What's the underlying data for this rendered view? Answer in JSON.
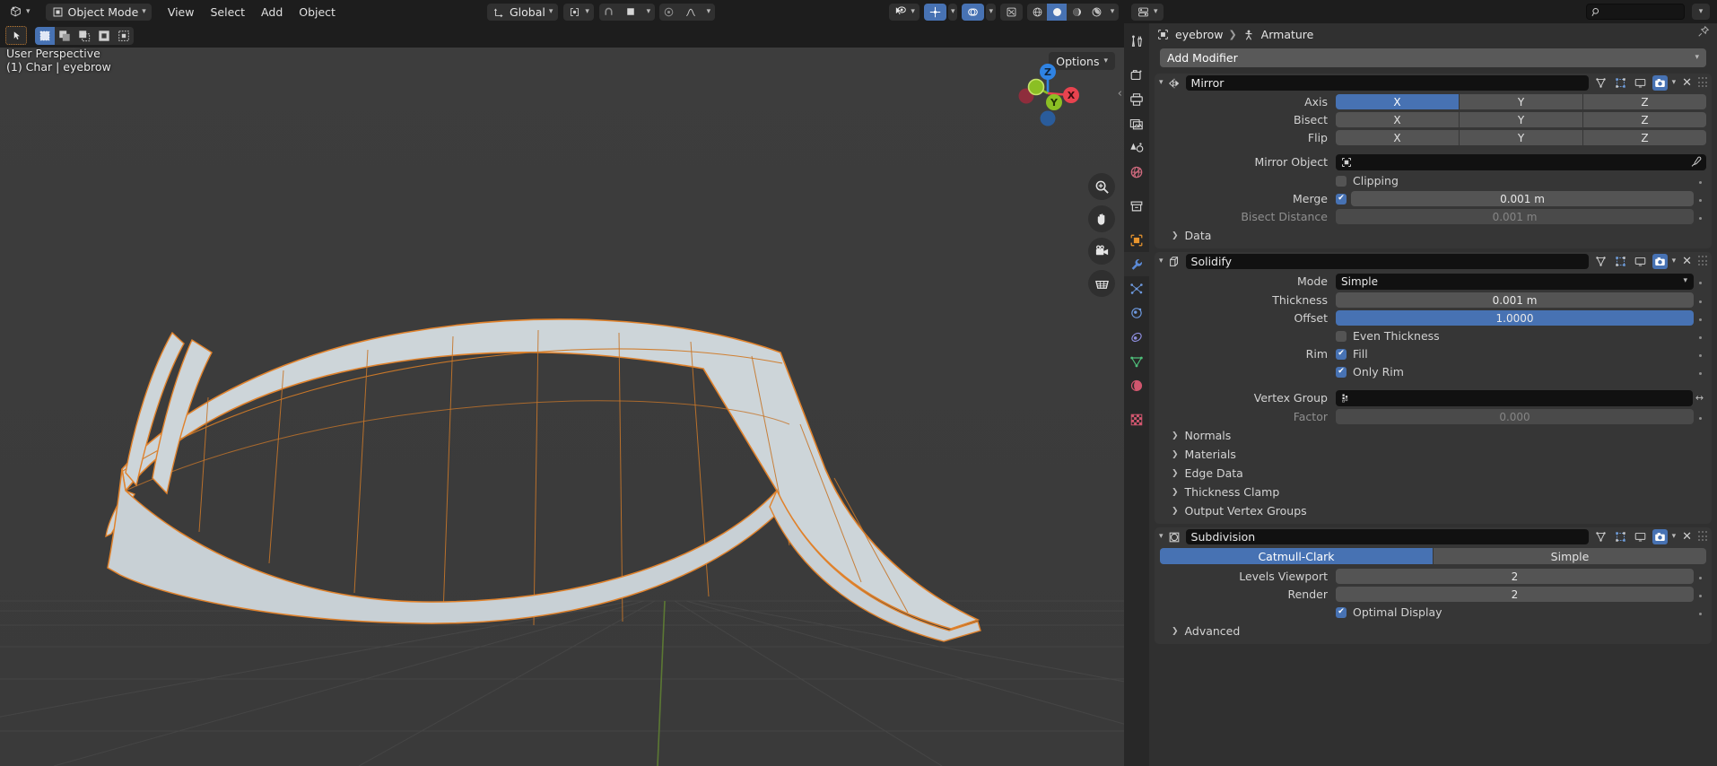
{
  "viewport_header": {
    "editor_type_icon": "editor-type-3dview-icon",
    "mode_selector": {
      "icon": "object-mode-icon",
      "label": "Object Mode"
    },
    "menus": [
      "View",
      "Select",
      "Add",
      "Object"
    ],
    "transform_orientation": {
      "icon": "orientation-icon",
      "label": "Global"
    },
    "pivot_icon": "pivot-point-icon",
    "snap_icon": "snap-magnet-icon",
    "snap_target_icon": "snap-target-icon",
    "proportional_icon": "proportional-edit-icon",
    "proportional_falloff_icon": "falloff-curve-icon",
    "visibility_icon": "object-visibility-icon",
    "shading_icons": [
      "shading-wireframe-icon",
      "shading-solid-icon",
      "shading-material-icon",
      "shading-rendered-icon"
    ],
    "gizmo_icon": "gizmo-icon",
    "overlays_icon": "overlays-icon",
    "xray_icon": "xray-toggle-icon",
    "options_label": "Options"
  },
  "toolbar_row2": {
    "active_tool_icon": "tweak-tool-icon",
    "select_modes": [
      "select-set-icon",
      "select-extend-icon",
      "select-subtract-icon",
      "select-invert-icon",
      "select-intersect-icon"
    ]
  },
  "viewport_overlay": {
    "perspective": "User Perspective",
    "object_info": "(1) Char | eyebrow"
  },
  "nav_gizmo": {
    "axes": [
      {
        "name": "Z",
        "color": "#2f83e3",
        "label": "Z"
      },
      {
        "name": "Y",
        "color": "#8bbf24",
        "label": "Y"
      },
      {
        "name": "X",
        "color": "#e8434f",
        "label": "X"
      }
    ]
  },
  "viewport_tools": [
    {
      "name": "zoom-icon"
    },
    {
      "name": "hand-pan-icon"
    },
    {
      "name": "camera-view-icon"
    },
    {
      "name": "toggle-ortho-icon"
    }
  ],
  "properties": {
    "editor_type_icon": "editor-type-properties-icon",
    "search_placeholder": "",
    "search_value": "",
    "search_icon": "search-icon",
    "pin_icon": "pin-icon",
    "breadcrumb": [
      {
        "icon": "object-icon",
        "label": "eyebrow"
      },
      {
        "icon": "armature-icon",
        "label": "Armature"
      }
    ],
    "nav_tabs": [
      {
        "name": "tool",
        "icon": "tool-wrench-screwdriver-icon",
        "color": "#d4d4d4",
        "active": false
      },
      {
        "name": "render",
        "icon": "render-camera-icon",
        "color": "#d4d4d4",
        "active": false
      },
      {
        "name": "output",
        "icon": "output-printer-icon",
        "color": "#d4d4d4",
        "active": false
      },
      {
        "name": "view-layer",
        "icon": "view-layer-images-icon",
        "color": "#d4d4d4",
        "active": false
      },
      {
        "name": "scene",
        "icon": "scene-cone-icon",
        "color": "#d4d4d4",
        "active": false
      },
      {
        "name": "world",
        "icon": "world-globe-icon",
        "color": "#d06a7e",
        "active": false
      },
      {
        "name": "collection",
        "icon": "collection-box-icon",
        "color": "#d4d4d4",
        "active": false
      },
      {
        "name": "object",
        "icon": "object-square-icon",
        "color": "#e8952e",
        "active": false
      },
      {
        "name": "modifiers",
        "icon": "modifier-wrench-icon",
        "color": "#5b8ad6",
        "active": true
      },
      {
        "name": "particles",
        "icon": "particles-icon",
        "color": "#6e9ae0",
        "active": false
      },
      {
        "name": "physics",
        "icon": "physics-orbit-icon",
        "color": "#6e9ae0",
        "active": false
      },
      {
        "name": "constraints",
        "icon": "object-constraints-icon",
        "color": "#8f8fe0",
        "active": false
      },
      {
        "name": "data",
        "icon": "object-data-triangle-icon",
        "color": "#4fbf7a",
        "active": false
      },
      {
        "name": "material",
        "icon": "material-sphere-icon",
        "color": "#d0566e",
        "active": false
      },
      {
        "name": "texture",
        "icon": "texture-checker-icon",
        "color": "#d0566e",
        "active": false
      }
    ],
    "add_modifier_label": "Add Modifier",
    "modifier_header_icons": [
      "mod-edit-mode-on-cage-icon",
      "mod-edit-mode-icon",
      "mod-realtime-display-icon",
      "mod-render-icon"
    ],
    "modifiers": [
      {
        "name": "Mirror",
        "icon": "mirror-modifier-icon",
        "expanded": true,
        "rows": [
          {
            "type": "triple",
            "label": "Axis",
            "options": [
              "X",
              "Y",
              "Z"
            ],
            "active": [
              true,
              false,
              false
            ]
          },
          {
            "type": "triple",
            "label": "Bisect",
            "options": [
              "X",
              "Y",
              "Z"
            ],
            "active": [
              false,
              false,
              false
            ]
          },
          {
            "type": "triple",
            "label": "Flip",
            "options": [
              "X",
              "Y",
              "Z"
            ],
            "active": [
              false,
              false,
              false
            ]
          },
          {
            "type": "object",
            "label": "Mirror Object",
            "value": "",
            "icon": "object-icon",
            "right_icon": "eyedropper-icon"
          },
          {
            "type": "check",
            "label": "",
            "text": "Clipping",
            "checked": false
          },
          {
            "type": "check_value",
            "label": "Merge",
            "checked": true,
            "value": "0.001 m"
          },
          {
            "type": "value",
            "label": "Bisect Distance",
            "value": "0.001 m",
            "dim": true
          }
        ],
        "subpanels": [
          "Data"
        ]
      },
      {
        "name": "Solidify",
        "icon": "solidify-modifier-icon",
        "expanded": true,
        "rows": [
          {
            "type": "dropdown",
            "label": "Mode",
            "value": "Simple"
          },
          {
            "type": "value",
            "label": "Thickness",
            "value": "0.001 m"
          },
          {
            "type": "value_blue",
            "label": "Offset",
            "value": "1.0000"
          },
          {
            "type": "check",
            "label": "",
            "text": "Even Thickness",
            "checked": false
          },
          {
            "type": "check",
            "label": "Rim",
            "text": "Fill",
            "checked": true
          },
          {
            "type": "check",
            "label": "",
            "text": "Only Rim",
            "checked": true
          },
          {
            "type": "vgroup",
            "label": "Vertex Group",
            "value": "",
            "icon": "vertex-group-icon"
          },
          {
            "type": "value",
            "label": "Factor",
            "value": "0.000",
            "dim": true
          }
        ],
        "subpanels": [
          "Normals",
          "Materials",
          "Edge Data",
          "Thickness Clamp",
          "Output Vertex Groups"
        ]
      },
      {
        "name": "Subdivision",
        "icon": "subdivision-modifier-icon",
        "expanded": true,
        "duo": {
          "options": [
            "Catmull-Clark",
            "Simple"
          ],
          "active": [
            true,
            false
          ]
        },
        "rows": [
          {
            "type": "value",
            "label": "Levels Viewport",
            "value": "2"
          },
          {
            "type": "value",
            "label": "Render",
            "value": "2"
          },
          {
            "type": "check",
            "label": "",
            "text": "Optimal Display",
            "checked": true
          }
        ],
        "subpanels": [
          "Advanced"
        ]
      }
    ]
  },
  "colors": {
    "accent_blue": "#4772b3",
    "panel_bg": "#303030",
    "modifier_bg": "#363636",
    "header_bg": "#1d1d1d",
    "viewport_bg": "#3c3c3c",
    "mesh_outline": "#e0822c",
    "mesh_fill": "#cdd5d9"
  }
}
